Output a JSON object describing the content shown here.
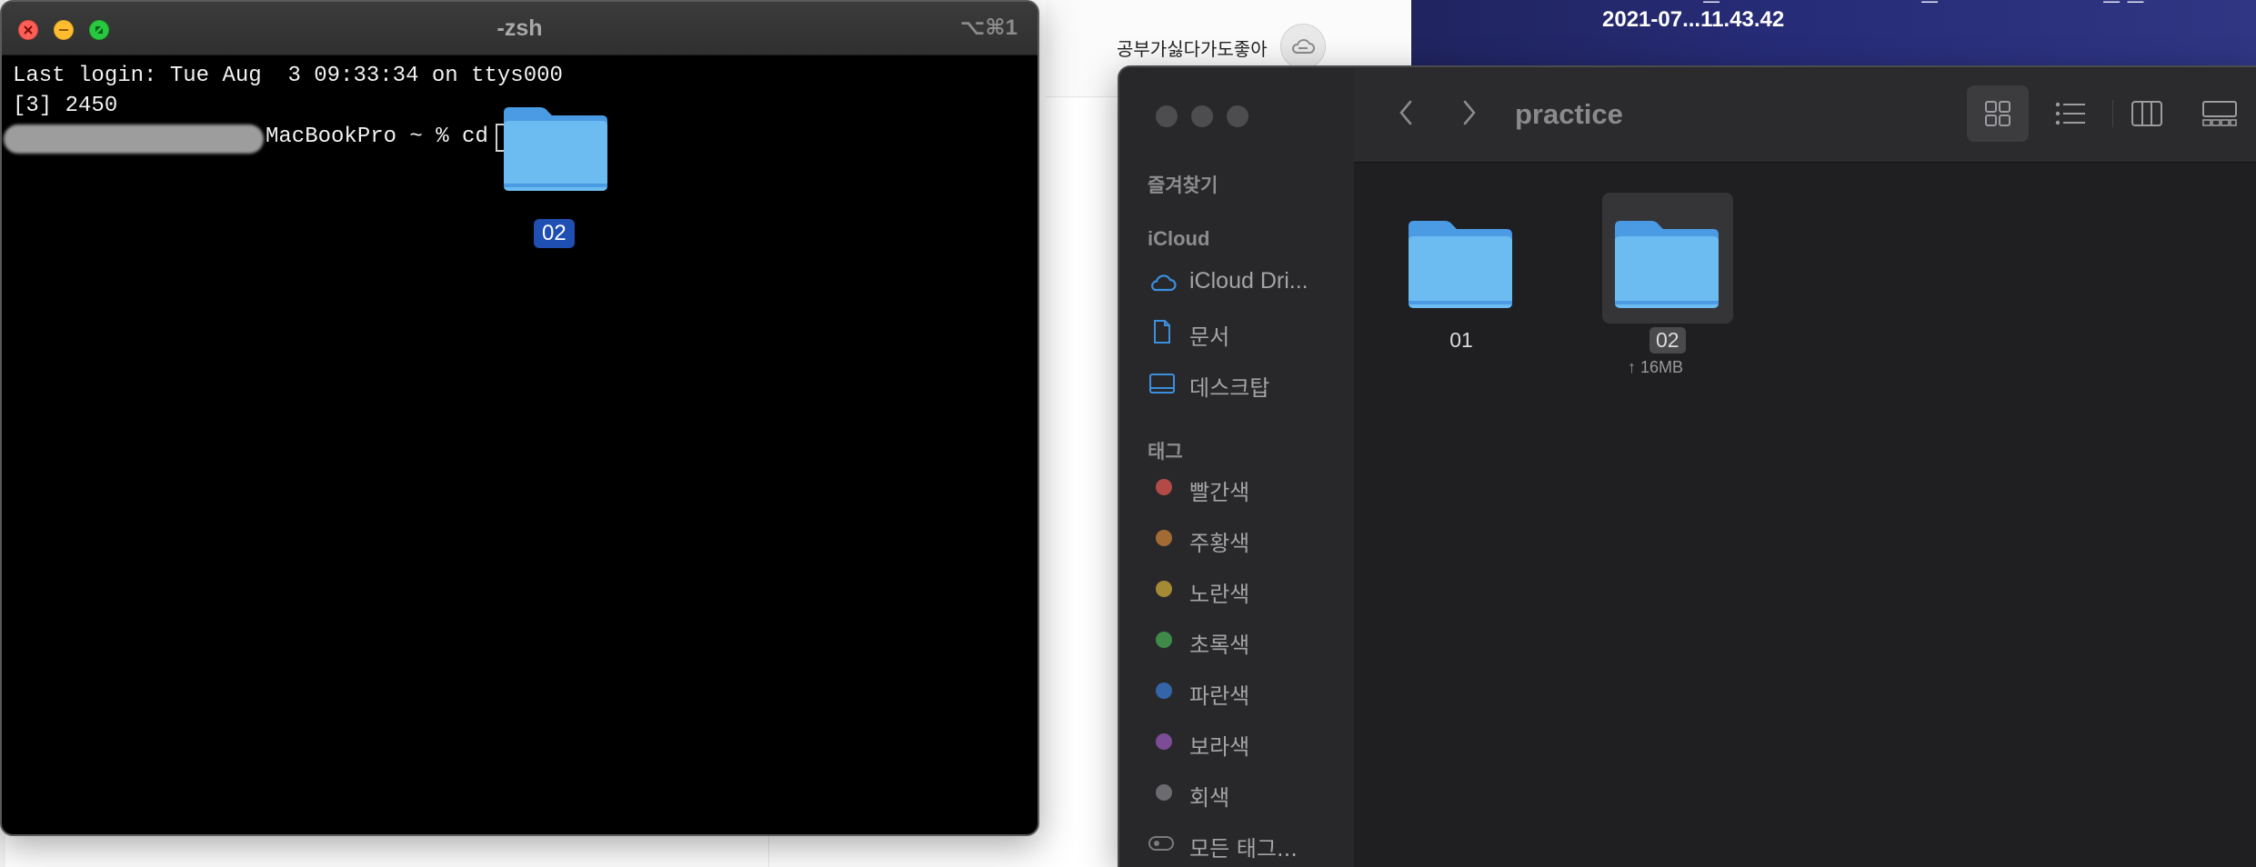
{
  "desktop": {
    "label": "공부가싫다가도좋아",
    "wallpaper_file_label": "2021-07...11.43.42"
  },
  "terminal": {
    "title": "-zsh",
    "shortcut": "⌥⌘1",
    "lines": [
      "Last login: Tue Aug  3 09:33:34 on ttys000",
      "[3] 2450"
    ],
    "prompt_text": "MacBookPro ~ % cd ",
    "dragged_folder_label": "02"
  },
  "finder": {
    "window_title": "practice",
    "sidebar": {
      "favorites_header": "즐겨찾기",
      "icloud_header": "iCloud",
      "icloud_items": [
        {
          "label": "iCloud Dri...",
          "icon": "cloud-icon"
        },
        {
          "label": "문서",
          "icon": "document-icon"
        },
        {
          "label": "데스크탑",
          "icon": "desktop-icon"
        }
      ],
      "tags_header": "태그",
      "tags": [
        {
          "label": "빨간색",
          "color": "#d34a4a"
        },
        {
          "label": "주황색",
          "color": "#d0802b"
        },
        {
          "label": "노란색",
          "color": "#c9a732"
        },
        {
          "label": "초록색",
          "color": "#3da552"
        },
        {
          "label": "파란색",
          "color": "#2f76d2"
        },
        {
          "label": "보라색",
          "color": "#9652b9"
        },
        {
          "label": "회색",
          "color": "#8e8e92"
        }
      ],
      "all_tags_label": "모든 태그..."
    },
    "files": [
      {
        "name": "01",
        "selected": false,
        "sub": ""
      },
      {
        "name": "02",
        "selected": true,
        "sub": "↑ 16MB"
      }
    ]
  }
}
